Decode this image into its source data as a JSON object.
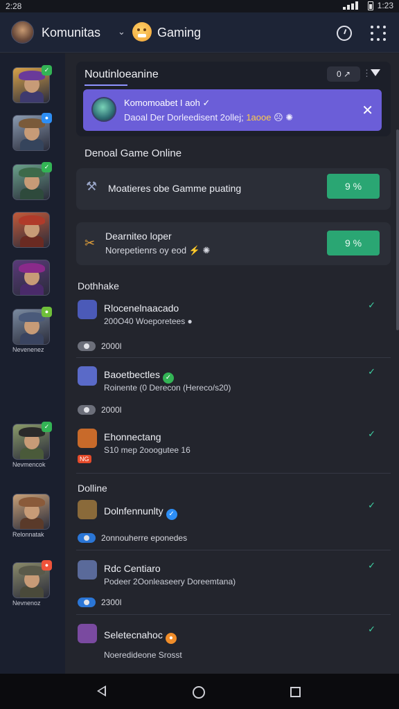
{
  "status": {
    "time": "2:28",
    "right_text": "1:23"
  },
  "topbar": {
    "title": "Komunitas",
    "subtitle": "Gaming"
  },
  "sidebar": {
    "items": [
      {
        "label": "",
        "badge": "✓",
        "badge_color": "#33b455",
        "hat": "#6a3a9a",
        "body": "#3e3a6e",
        "bg": "#d8a24a"
      },
      {
        "label": "",
        "badge": "●",
        "badge_color": "#2d8ef5",
        "hat": "#7a5a3a",
        "body": "#35445c",
        "bg": "#8a9ab0"
      },
      {
        "label": "",
        "badge": "✓",
        "badge_color": "#33b455",
        "hat": "#3d6a4a",
        "body": "#2e4a3c",
        "bg": "#6aa08a"
      },
      {
        "label": "",
        "badge": "",
        "badge_color": "",
        "hat": "#b03a2a",
        "body": "#6a2a22",
        "bg": "#c25a3a"
      },
      {
        "label": "",
        "badge": "",
        "badge_color": "",
        "hat": "#8a2a8a",
        "body": "#4a2a6a",
        "bg": "#5a3a7a"
      },
      {
        "label": "Nevenenez",
        "badge": "●",
        "badge_color": "#6fbf3a",
        "hat": "#4a5a7a",
        "body": "#3a4460",
        "bg": "#7a8aa0"
      },
      {
        "label": "Nevmencok",
        "badge": "✓",
        "badge_color": "#33b455",
        "hat": "#2a2a2a",
        "body": "#4a5a3a",
        "bg": "#8a9a6a"
      },
      {
        "label": "Relonnatak",
        "badge": "",
        "badge_color": "",
        "hat": "#8a5a3a",
        "body": "#5a3a2a",
        "bg": "#c8a078"
      },
      {
        "label": "Nevnenoz",
        "badge": "●",
        "badge_color": "#f0533a",
        "hat": "#5a5a4a",
        "body": "#4a4a3a",
        "bg": "#8a8a6a"
      }
    ]
  },
  "notifications": {
    "title": "Noutinloeanine",
    "control_label": "0 ↗",
    "banner": {
      "title": "Komomoabet I aoh ✓",
      "text_pre": "Daoal Der Dorleedisent 2ollej; ",
      "text_highlight": "1aooe",
      "text_post": " ☹ ✺"
    }
  },
  "online_section": {
    "heading": "Denoal Game Online",
    "cards": [
      {
        "icon": "⚒",
        "name": "Moatieres obe Gamme puating",
        "sub": "",
        "pct": "9 %"
      },
      {
        "icon": "✂",
        "name": "Dearniteo loper",
        "sub": "Norepetienrs oy eod ⚡ ✺",
        "pct": "9 %"
      }
    ]
  },
  "dothake_section": {
    "heading": "Dothhake",
    "rows": [
      {
        "name": "Rlocenelnaacado",
        "sub": "200O40 Woeporetees ●",
        "meta": "2000l",
        "pill": "grey",
        "icon_bg": "#4b5ab8",
        "badge": ""
      },
      {
        "name": "Baoetbectles",
        "sub": "Roinente (0 Derecon (Hereco/s20)",
        "meta": "2000l",
        "pill": "grey",
        "icon_bg": "#5a6ac8",
        "badge": "✓"
      },
      {
        "name": "Ehonnectang",
        "sub": "S10 mep 2ooogutee 16",
        "meta": "NG",
        "pill": "red",
        "icon_bg": "#c86a2a",
        "badge": ""
      }
    ]
  },
  "dolline_section": {
    "heading": "Dolline",
    "rows": [
      {
        "name": "Dolnfennunlty",
        "sub": "",
        "meta": "2onnouherre eponedes",
        "pill": "blue",
        "icon_bg": "#8a6a3a",
        "badge": "✓"
      },
      {
        "name": "Rdc Centiaro",
        "sub": "Podeer 2Oonleaseery Doreemtana)",
        "meta": "2300l",
        "pill": "blue",
        "icon_bg": "#5a6a9a",
        "badge": ""
      },
      {
        "name": "Seletecnahoc",
        "sub": "Noeredideone Srosst",
        "meta": "",
        "pill": "",
        "icon_bg": "#7a4aa0",
        "badge": "●"
      }
    ]
  }
}
